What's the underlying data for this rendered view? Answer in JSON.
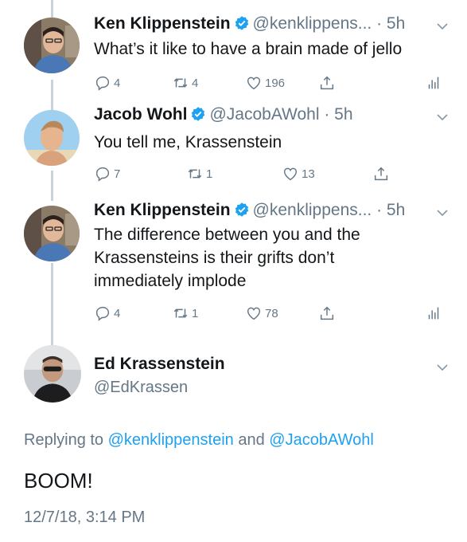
{
  "tweets": [
    {
      "name": "Ken Klippenstein",
      "handle_time": "@kenklippens... · 5h",
      "text": "What’s it like to have a brain made of jello",
      "replies": "4",
      "retweets": "4",
      "likes": "196"
    },
    {
      "name": "Jacob Wohl",
      "handle_time": "@JacobAWohl · 5h",
      "text": "You tell me, Krassenstein",
      "replies": "7",
      "retweets": "1",
      "likes": "13"
    },
    {
      "name": "Ken Klippenstein",
      "handle_time": "@kenklippens... · 5h",
      "text": "The difference between you and the Krassensteins is their grifts don’t immediately implode",
      "replies": "4",
      "retweets": "1",
      "likes": "78"
    }
  ],
  "focus": {
    "name": "Ed Krassenstein",
    "handle": "@EdKrassen",
    "replying_prefix": "Replying to ",
    "reply_user_1": "@kenklippenstein",
    "replying_and": " and ",
    "reply_user_2": "@JacobAWohl",
    "text": "BOOM!",
    "timestamp": "12/7/18, 3:14 PM"
  },
  "colors": {
    "accent": "#1da1f2",
    "secondary_text": "#657786",
    "thread_line": "#c9d4da"
  },
  "icons": [
    "verified-badge-icon",
    "chevron-down-icon",
    "reply-icon",
    "retweet-icon",
    "like-icon",
    "share-icon",
    "analytics-icon"
  ]
}
